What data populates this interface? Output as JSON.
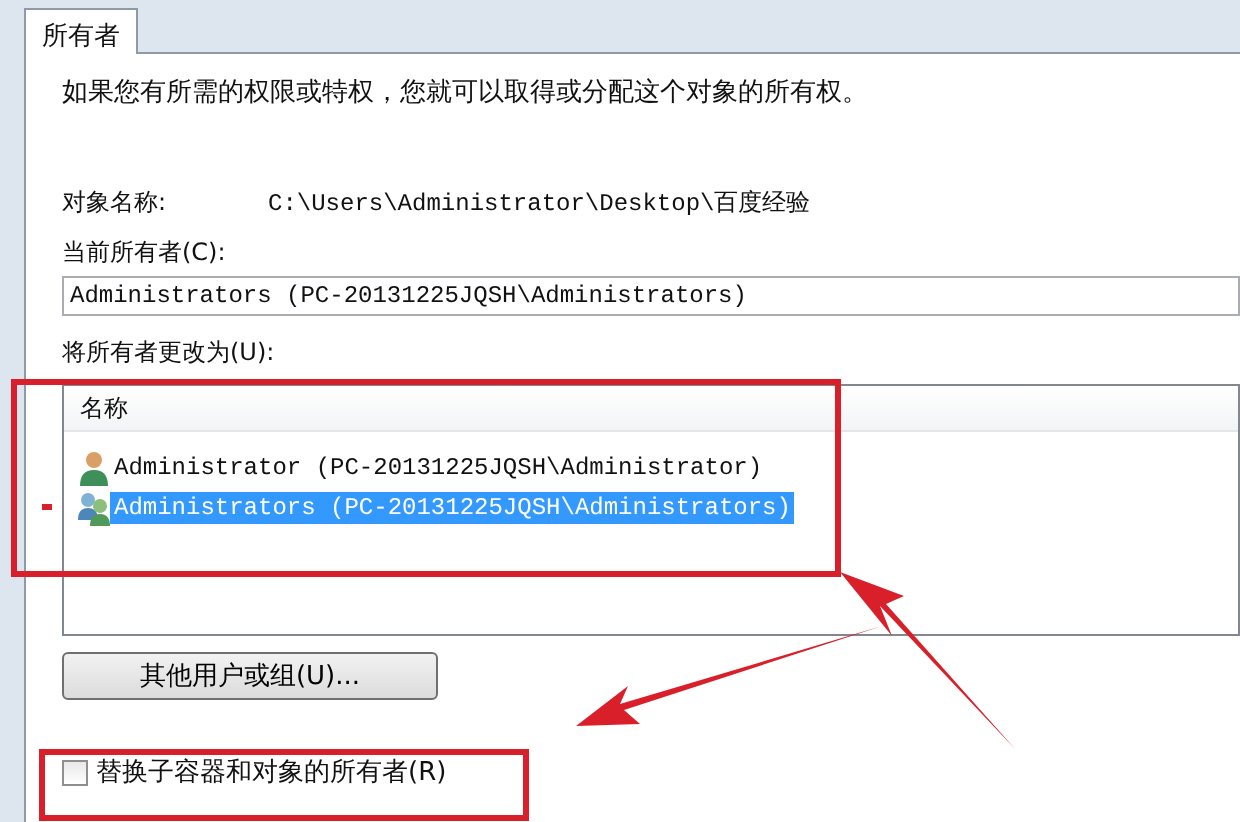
{
  "tabs": [
    {
      "label": "所有者",
      "selected": true
    }
  ],
  "intro": "如果您有所需的权限或特权，您就可以取得或分配这个对象的所有权。",
  "object_name": {
    "label": "对象名称:",
    "value": "C:\\Users\\Administrator\\Desktop\\百度经验"
  },
  "current_owner": {
    "label": "当前所有者(C):",
    "value": "Administrators (PC-20131225JQSH\\Administrators)"
  },
  "change_owner": {
    "label": "将所有者更改为(U):",
    "columns": [
      "名称"
    ],
    "rows": [
      {
        "kind": "user",
        "name": "Administrator (PC-20131225JQSH\\Administrator)",
        "selected": false
      },
      {
        "kind": "group",
        "name": "Administrators (PC-20131225JQSH\\Administrators)",
        "selected": true
      }
    ]
  },
  "other_button": "其他用户或组(U)...",
  "replace_checkbox": {
    "label": "替换子容器和对象的所有者(R)",
    "checked": false
  }
}
